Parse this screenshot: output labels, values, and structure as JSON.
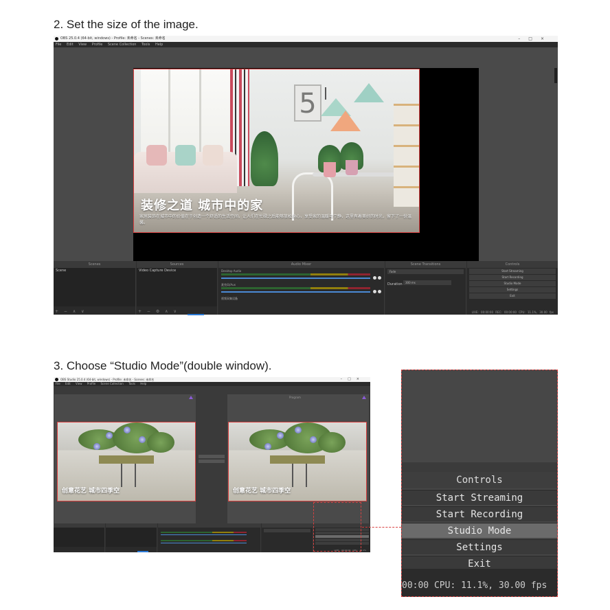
{
  "steps": {
    "step2_title": "2. Set the size of the image.",
    "step3_title": "3. Choose “Studio Mode”(double window)."
  },
  "window1": {
    "title": "OBS 25.0.4 (64-bit, windows) - Profile: 未命名 - Scenes: 未命名",
    "window_controls": "–□×",
    "menu": [
      "File",
      "Edit",
      "View",
      "Profile",
      "Scene Collection",
      "Tools",
      "Help"
    ],
    "photo": {
      "frame_number": "5",
      "headline": "装修之道  城市中的家",
      "subline": "家居装饰在城市中的价值在于创造一个舒适的生活空间，让人们在忙碌之后能够放松身心，享受家的温暖与宁静，这里有着美好的时光，留下了一份温馨。"
    },
    "docks": {
      "scenes_header": "Scenes",
      "scenes_item": "Scene",
      "scenes_foot": "+ − ∧ ∨",
      "sources_header": "Sources",
      "sources_item": "Video Capture Device",
      "sources_foot": "+ − ⚙ ∧ ∨",
      "mixer_header": "Audio Mixer",
      "mixer_track1": "Desktop Audio",
      "mixer_track2": "麦克风/Aux",
      "mixer_track3": "视频采集设备",
      "transitions_header": "Scene Transitions",
      "transition_value": "Fade",
      "duration_label": "Duration",
      "duration_value": "300 ms",
      "controls_header": "Controls",
      "controls": [
        "Start Streaming",
        "Start Recording",
        "Studio Mode",
        "Settings",
        "Exit"
      ],
      "status": "LIVE: 00:00:00   REC: 00:00:00   CPU: 11.1%, 30.00 fps"
    }
  },
  "window2": {
    "title": "OBS Studio 25.0.4 (64-bit, windows) - Profile: 未命名 - Scenes: 未命名",
    "window_controls": "–□×",
    "menu": [
      "File",
      "Edit",
      "View",
      "Profile",
      "Scene Collection",
      "Tools",
      "Help"
    ],
    "program_label": "Program",
    "flower_text": "创意花艺  城市四季空",
    "status": "LIVE: 00:00:00  CPU: 11.1%"
  },
  "zoom": {
    "header": "Controls",
    "buttons": [
      "Start Streaming",
      "Start Recording",
      "Studio Mode",
      "Settings",
      "Exit"
    ],
    "active_button": "Studio Mode",
    "status": "00:00   CPU: 11.1%, 30.00 fps"
  },
  "colors": {
    "highlight_border": "#d94040",
    "obs_dark": "#2b2b2b",
    "active_button": "#6b6b6b",
    "mixer_blue": "#4b8bd6"
  }
}
